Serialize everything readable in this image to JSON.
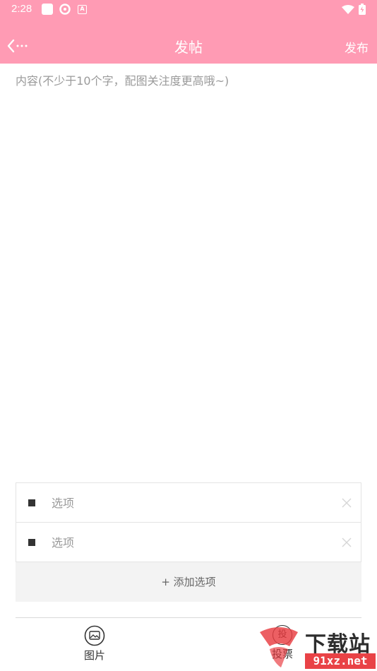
{
  "status_bar": {
    "time": "2:28",
    "icons": [
      "square-notification-icon",
      "aperture-icon",
      "a-icon",
      "wifi-icon",
      "battery-icon"
    ]
  },
  "header": {
    "title": "发帖",
    "publish_label": "发布",
    "background_color": "#ff9bb4"
  },
  "editor": {
    "placeholder": "内容(不少于10个字，配图关注度更高哦~)"
  },
  "vote_options": [
    {
      "placeholder": "选项"
    },
    {
      "placeholder": "选项"
    }
  ],
  "add_option_label": "+ 添加选项",
  "toolbar": {
    "image_label": "图片",
    "vote_label": "投票",
    "vote_glyph": "投"
  },
  "watermark": {
    "big_text": "下载站",
    "url": "91xz.net"
  }
}
